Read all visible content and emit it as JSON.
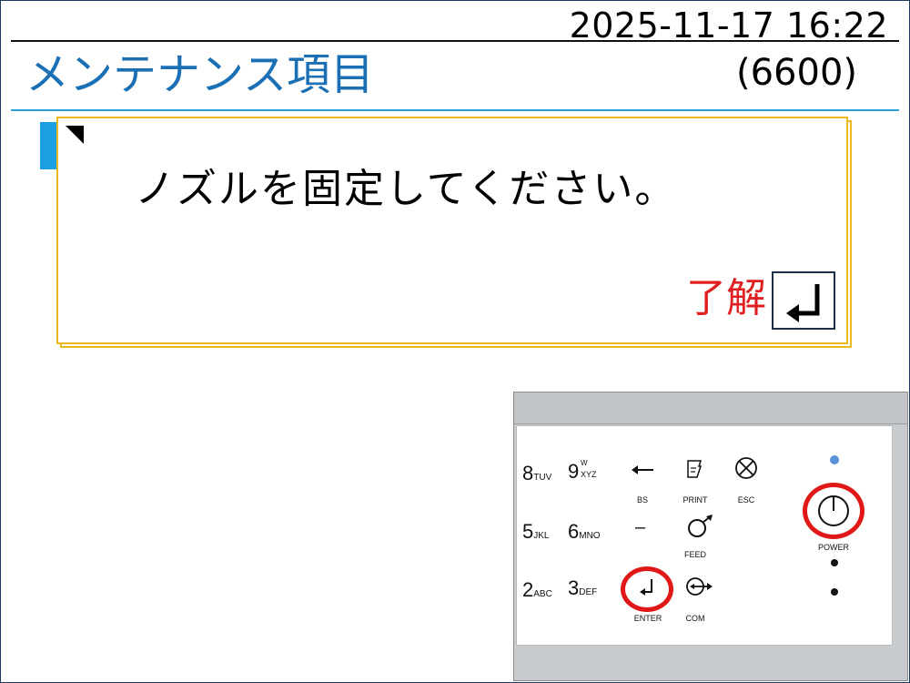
{
  "header": {
    "datetime": "2025-11-17 16:22",
    "title": "メンテナンス項目",
    "code": "(6600)"
  },
  "dialog": {
    "message": "ノズルを固定してください。",
    "ok_label": "了解",
    "enter_icon": "enter-return-icon"
  },
  "keypad": {
    "keys": {
      "k8": "8",
      "k8_sub": "TUV",
      "k9": "9",
      "k9_sup": "W",
      "k9_sub": "XYZ",
      "k5": "5",
      "k5_sub": "JKL",
      "k6": "6",
      "k6_sub": "MNO",
      "k2": "2",
      "k2_sub": "ABC",
      "k3": "3",
      "k3_sub": "DEF"
    },
    "labels": {
      "bs": "BS",
      "print": "PRINT",
      "esc": "ESC",
      "feed": "FEED",
      "enter": "ENTER",
      "com": "COM",
      "power": "POWER"
    },
    "minus": "–",
    "highlight_color": "#e01818",
    "led_color": "#5a92d8"
  }
}
